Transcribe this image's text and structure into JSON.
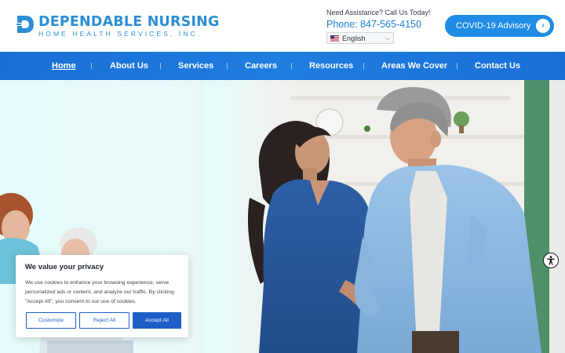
{
  "header": {
    "logo_name": "DEPENDABLE NURSING",
    "logo_sub": "HOME HEALTH SERVICES, INC.",
    "assist_text": "Need Assistance? Call Us Today!",
    "phone": "Phone: 847-565-4150",
    "language": "English",
    "covid_label": "COVID-19 Advisory"
  },
  "nav": {
    "items": [
      {
        "label": "Home",
        "active": true
      },
      {
        "label": "About Us"
      },
      {
        "label": "Services"
      },
      {
        "label": "Careers"
      },
      {
        "label": "Resources"
      },
      {
        "label": "Areas We Cover"
      },
      {
        "label": "Contact Us"
      }
    ]
  },
  "cookie": {
    "title": "We value your privacy",
    "body": "We use cookies to enhance your browsing experience, serve personalized ads or content, and analyze our traffic. By clicking \"Accept All\", you consent to our use of cookies.",
    "customize": "Customize",
    "reject": "Reject All",
    "accept": "Accept All"
  },
  "colors": {
    "brand": "#2b8fd4",
    "nav": "#1a6fd6",
    "accent": "#1f8ce6",
    "cookie_button": "#1d5fc7"
  },
  "icons": {
    "logo": "d-logo-icon",
    "flag": "us-flag-icon",
    "dropdown": "chevron-down-icon",
    "covid_arrow": "chevron-right-icon",
    "accessibility": "accessibility-icon"
  }
}
